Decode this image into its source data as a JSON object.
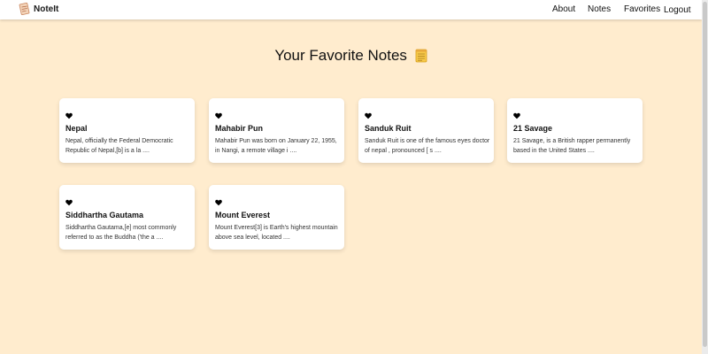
{
  "navbar": {
    "brand": "NoteIt",
    "links": [
      "About",
      "Notes",
      "Favorites",
      "Logout"
    ]
  },
  "page": {
    "title": "Your Favorite Notes"
  },
  "notes": [
    {
      "title": "Nepal",
      "excerpt": "Nepal, officially the Federal Democratic Republic of Nepal,[b] is a la ...."
    },
    {
      "title": "Mahabir Pun",
      "excerpt": "Mahabir Pun was born on January 22, 1955, in Nangi, a remote village i ...."
    },
    {
      "title": "Sanduk Ruit",
      "excerpt": "Sanduk Ruit is one of the famous eyes doctor of nepal , pronounced [ s ...."
    },
    {
      "title": "21 Savage",
      "excerpt": "21 Savage, is a British rapper permanently based in the United States ...."
    },
    {
      "title": "Siddhartha Gautama",
      "excerpt": "Siddhartha Gautama,[e] most commonly referred to as the Buddha ('the a ...."
    },
    {
      "title": "Mount Everest",
      "excerpt": "Mount Everest[3] is Earth's highest mountain above sea level, located ...."
    }
  ],
  "icons": {
    "brand": "notepad-logo-icon",
    "title": "memo-icon",
    "favorite": "heart-icon"
  },
  "colors": {
    "background": "#ffecce",
    "card": "#ffffff",
    "navbar": "#ffffff",
    "text": "#111111"
  }
}
